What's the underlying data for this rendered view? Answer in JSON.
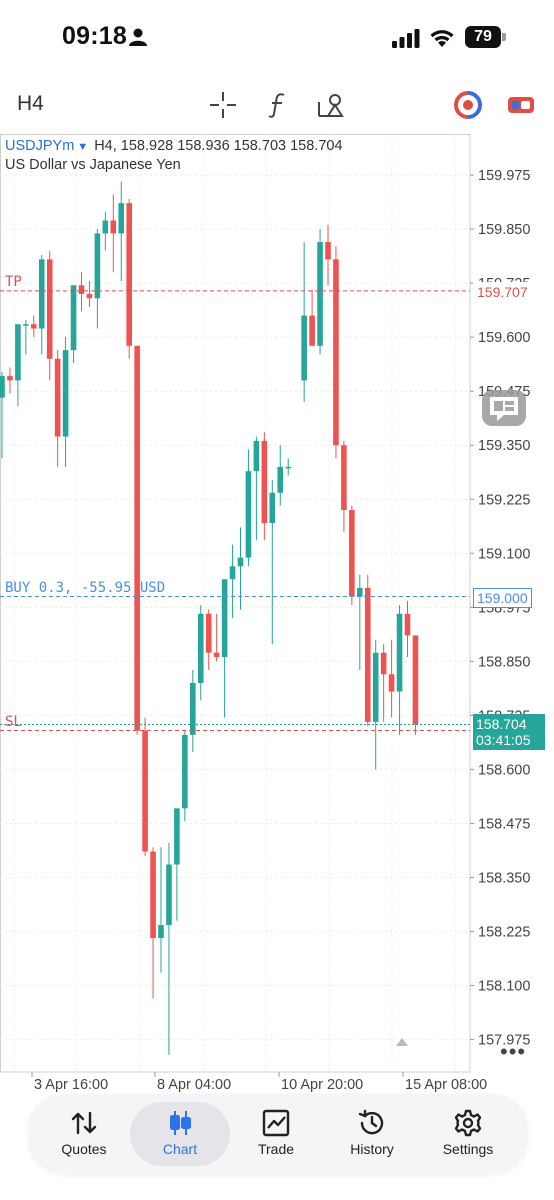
{
  "status_bar": {
    "time": "09:18",
    "battery": "79"
  },
  "toolbar": {
    "timeframe": "H4",
    "icons": [
      "crosshair-icon",
      "indicator-f-icon",
      "drawing-objects-icon",
      "brand-logo-icon",
      "trade-panel-toggle-icon"
    ]
  },
  "chart": {
    "symbol": "USDJPYm",
    "ohlc_text": "H4, 158.928 158.936 158.703 158.704",
    "description": "US Dollar vs Japanese Yen",
    "tp_label": "TP",
    "tp_price": "159.707",
    "sl_label": "SL",
    "buy_label": "BUY 0.3, -55.95 USD",
    "buy_price": "159.000",
    "current_price": "158.704",
    "countdown": "03:41:05",
    "colors": {
      "bull": "#26a69a",
      "bear": "#ef5350",
      "tp_sl": "#d9534f",
      "buy": "#4a90e2"
    }
  },
  "chart_data": {
    "type": "candlestick",
    "title": "USDJPYm",
    "ylim": [
      157.9,
      160.07
    ],
    "y_ticks": [
      "159.975",
      "159.850",
      "159.725",
      "159.600",
      "159.475",
      "159.350",
      "159.225",
      "159.100",
      "158.975",
      "158.850",
      "158.725",
      "158.600",
      "158.475",
      "158.350",
      "158.225",
      "158.100",
      "157.975"
    ],
    "x_ticks": [
      "3 Apr 16:00",
      "8 Apr 04:00",
      "10 Apr 20:00",
      "15 Apr 08:00"
    ],
    "levels": {
      "tp": 159.707,
      "buy": 159.0,
      "sl": 158.69,
      "current": 158.704
    },
    "candles": [
      {
        "o": 159.46,
        "h": 159.52,
        "l": 159.32,
        "c": 159.51
      },
      {
        "o": 159.51,
        "h": 159.53,
        "l": 159.47,
        "c": 159.5
      },
      {
        "o": 159.5,
        "h": 159.62,
        "l": 159.44,
        "c": 159.63
      },
      {
        "o": 159.63,
        "h": 159.64,
        "l": 159.56,
        "c": 159.63
      },
      {
        "o": 159.63,
        "h": 159.65,
        "l": 159.6,
        "c": 159.62
      },
      {
        "o": 159.62,
        "h": 159.79,
        "l": 159.56,
        "c": 159.78
      },
      {
        "o": 159.78,
        "h": 159.8,
        "l": 159.5,
        "c": 159.55
      },
      {
        "o": 159.55,
        "h": 159.57,
        "l": 159.3,
        "c": 159.37
      },
      {
        "o": 159.37,
        "h": 159.6,
        "l": 159.3,
        "c": 159.57
      },
      {
        "o": 159.57,
        "h": 159.72,
        "l": 159.54,
        "c": 159.72
      },
      {
        "o": 159.72,
        "h": 159.75,
        "l": 159.66,
        "c": 159.7
      },
      {
        "o": 159.7,
        "h": 159.73,
        "l": 159.67,
        "c": 159.69
      },
      {
        "o": 159.69,
        "h": 159.85,
        "l": 159.62,
        "c": 159.84
      },
      {
        "o": 159.84,
        "h": 159.89,
        "l": 159.8,
        "c": 159.87
      },
      {
        "o": 159.87,
        "h": 159.93,
        "l": 159.75,
        "c": 159.84
      },
      {
        "o": 159.84,
        "h": 159.96,
        "l": 159.73,
        "c": 159.91
      },
      {
        "o": 159.91,
        "h": 159.92,
        "l": 159.55,
        "c": 159.58
      },
      {
        "o": 159.58,
        "h": 159.58,
        "l": 158.68,
        "c": 158.69
      },
      {
        "o": 158.69,
        "h": 158.72,
        "l": 158.4,
        "c": 158.41
      },
      {
        "o": 158.41,
        "h": 158.42,
        "l": 158.07,
        "c": 158.21
      },
      {
        "o": 158.21,
        "h": 158.42,
        "l": 158.13,
        "c": 158.24
      },
      {
        "o": 158.24,
        "h": 158.43,
        "l": 157.94,
        "c": 158.38
      },
      {
        "o": 158.38,
        "h": 158.5,
        "l": 158.25,
        "c": 158.51
      },
      {
        "o": 158.51,
        "h": 158.69,
        "l": 158.48,
        "c": 158.68
      },
      {
        "o": 158.68,
        "h": 158.83,
        "l": 158.64,
        "c": 158.8
      },
      {
        "o": 158.8,
        "h": 158.98,
        "l": 158.76,
        "c": 158.96
      },
      {
        "o": 158.96,
        "h": 158.97,
        "l": 158.83,
        "c": 158.87
      },
      {
        "o": 158.87,
        "h": 158.96,
        "l": 158.85,
        "c": 158.86
      },
      {
        "o": 158.86,
        "h": 159.04,
        "l": 158.72,
        "c": 159.04
      },
      {
        "o": 159.04,
        "h": 159.12,
        "l": 158.95,
        "c": 159.07
      },
      {
        "o": 159.07,
        "h": 159.16,
        "l": 158.97,
        "c": 159.09
      },
      {
        "o": 159.09,
        "h": 159.34,
        "l": 159.07,
        "c": 159.29
      },
      {
        "o": 159.29,
        "h": 159.37,
        "l": 159.13,
        "c": 159.36
      },
      {
        "o": 159.36,
        "h": 159.38,
        "l": 159.13,
        "c": 159.17
      },
      {
        "o": 159.17,
        "h": 159.27,
        "l": 158.89,
        "c": 159.24
      },
      {
        "o": 159.24,
        "h": 159.35,
        "l": 159.21,
        "c": 159.3
      },
      {
        "o": 159.3,
        "h": 159.32,
        "l": 159.28,
        "c": 159.3
      },
      {
        "o": 159.5,
        "h": 159.82,
        "l": 159.45,
        "c": 159.65
      },
      {
        "o": 159.65,
        "h": 159.71,
        "l": 159.58,
        "c": 159.58
      },
      {
        "o": 159.58,
        "h": 159.85,
        "l": 159.56,
        "c": 159.82
      },
      {
        "o": 159.82,
        "h": 159.86,
        "l": 159.72,
        "c": 159.78
      },
      {
        "o": 159.78,
        "h": 159.81,
        "l": 159.32,
        "c": 159.35
      },
      {
        "o": 159.35,
        "h": 159.36,
        "l": 159.15,
        "c": 159.2
      },
      {
        "o": 159.2,
        "h": 159.21,
        "l": 158.98,
        "c": 159.0
      },
      {
        "o": 159.0,
        "h": 159.05,
        "l": 158.83,
        "c": 159.02
      },
      {
        "o": 159.02,
        "h": 159.05,
        "l": 158.7,
        "c": 158.71
      },
      {
        "o": 158.71,
        "h": 158.9,
        "l": 158.6,
        "c": 158.87
      },
      {
        "o": 158.87,
        "h": 158.89,
        "l": 158.71,
        "c": 158.82
      },
      {
        "o": 158.82,
        "h": 158.9,
        "l": 158.72,
        "c": 158.78
      },
      {
        "o": 158.78,
        "h": 158.98,
        "l": 158.68,
        "c": 158.96
      },
      {
        "o": 158.96,
        "h": 158.99,
        "l": 158.86,
        "c": 158.91
      },
      {
        "o": 158.91,
        "h": 158.91,
        "l": 158.68,
        "c": 158.704
      }
    ]
  },
  "bottom_nav": {
    "items": [
      {
        "label": "Quotes",
        "icon": "arrows-updown-icon"
      },
      {
        "label": "Chart",
        "icon": "candles-icon",
        "active": true
      },
      {
        "label": "Trade",
        "icon": "trend-chart-icon"
      },
      {
        "label": "History",
        "icon": "history-clock-icon"
      },
      {
        "label": "Settings",
        "icon": "gear-icon"
      }
    ]
  }
}
